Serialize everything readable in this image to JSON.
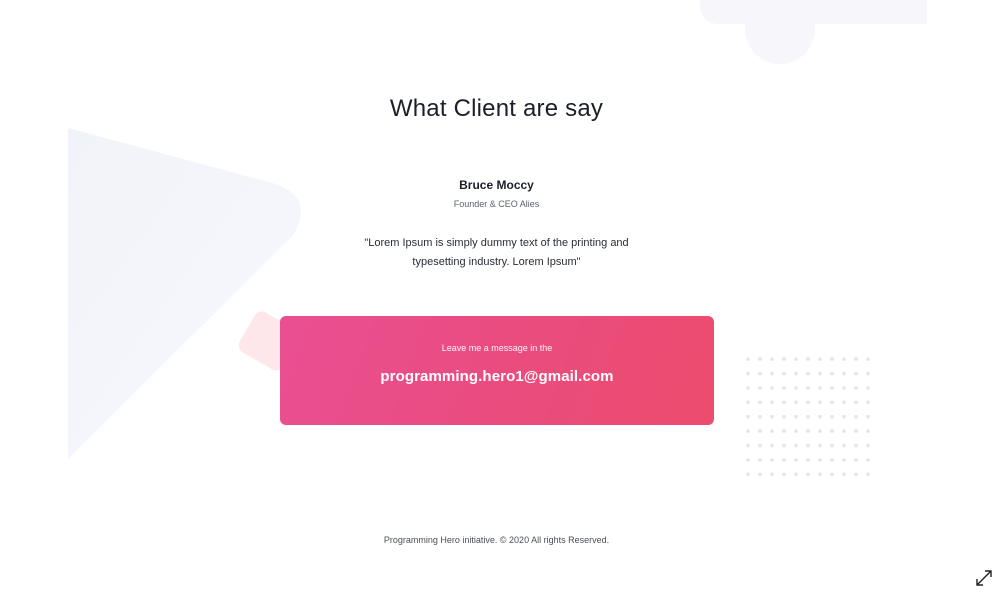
{
  "testimonials": {
    "title": "What Client are say",
    "client_name": "Bruce Moccy",
    "client_role": "Founder & CEO Alies",
    "quote": "\"Lorem Ipsum is simply dummy text of the printing and typesetting industry. Lorem Ipsum\""
  },
  "contact_card": {
    "label": "Leave me a message in the",
    "email": "programming.hero1@gmail.com",
    "colors": {
      "gradient_start": "#ea4f92",
      "gradient_end": "#ec4c6d"
    }
  },
  "footer": {
    "text": "Programming Hero initiative. © 2020 All rights Reserved."
  },
  "controls": {
    "expand_icon": "expand-diagonal-icon"
  }
}
